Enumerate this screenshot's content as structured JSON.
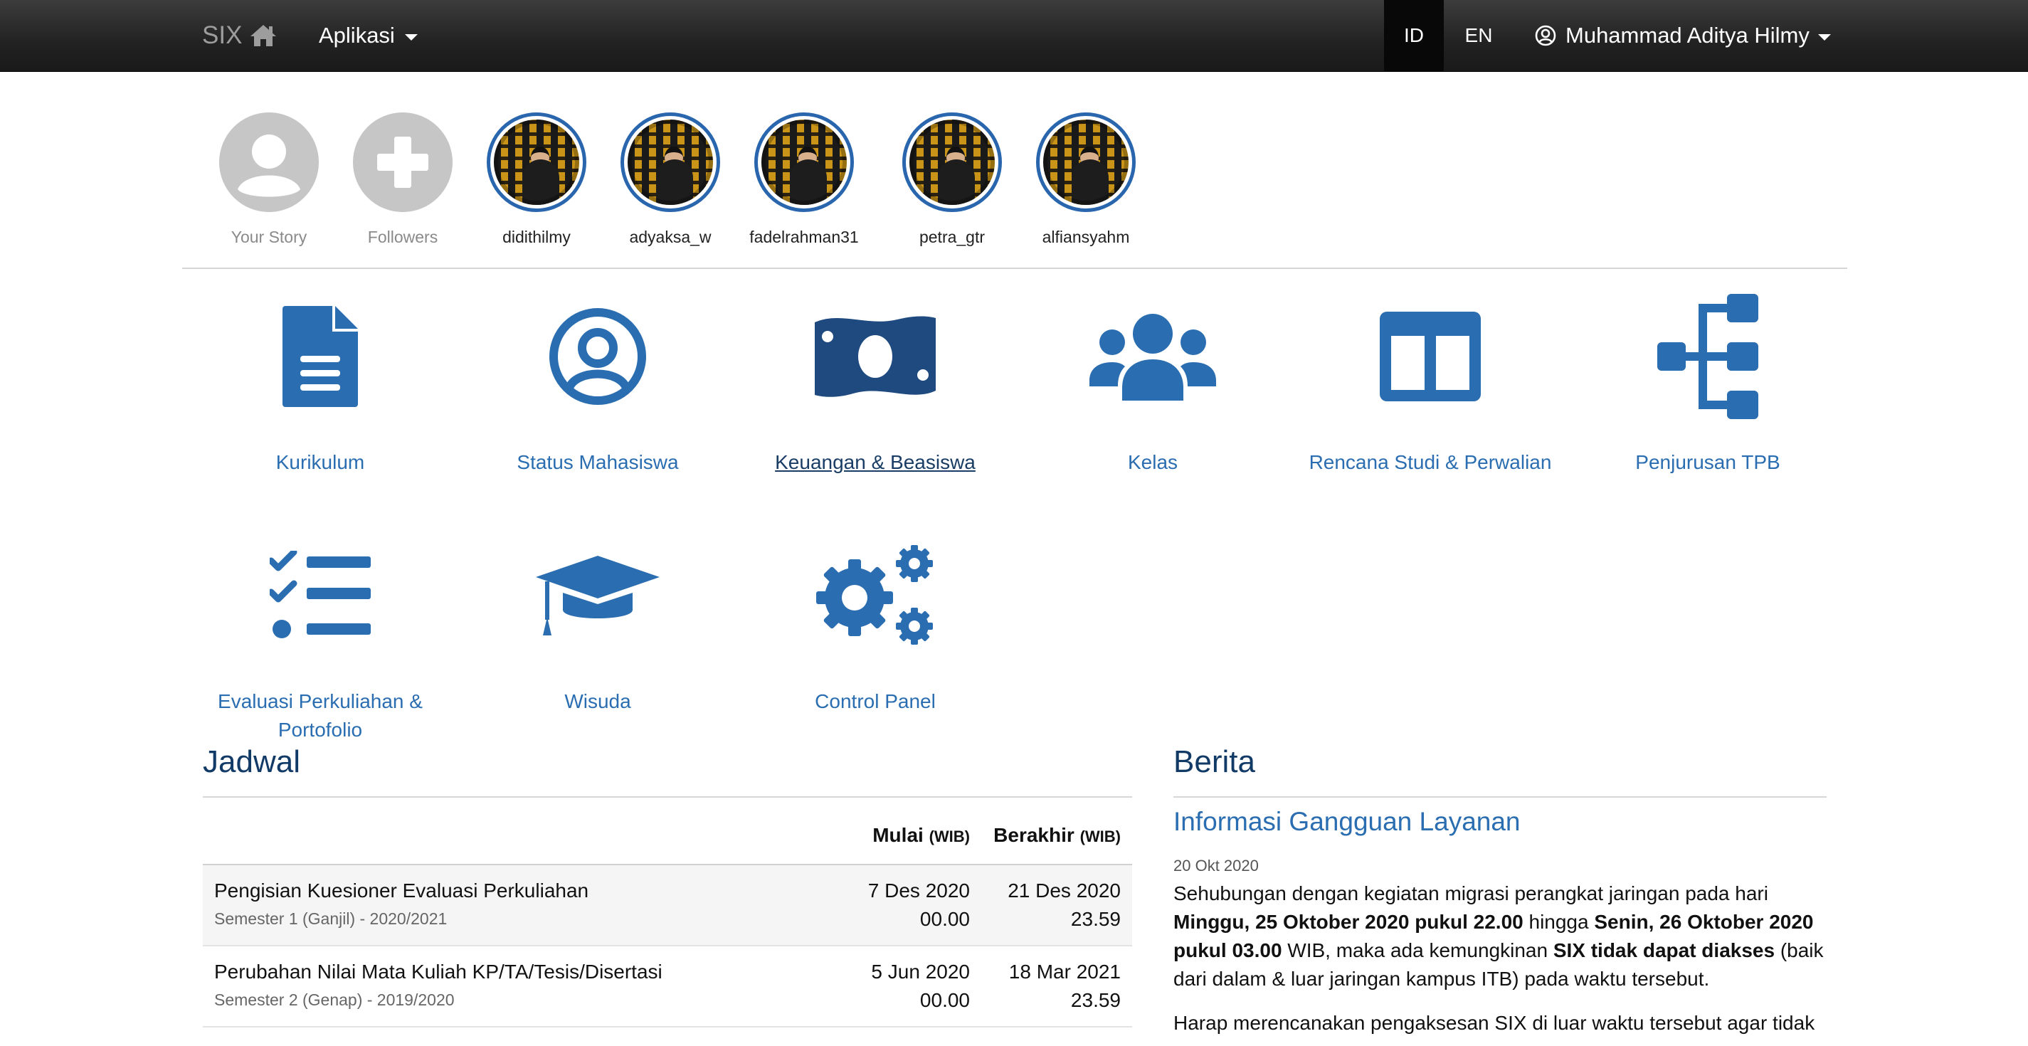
{
  "navbar": {
    "brand": "SIX",
    "apps_menu": "Aplikasi",
    "lang_id": "ID",
    "lang_en": "EN",
    "user_name": "Muhammad Aditya Hilmy"
  },
  "stories": [
    {
      "label": "Your Story",
      "type": "placeholder"
    },
    {
      "label": "Followers",
      "type": "add"
    },
    {
      "label": "didithilmy",
      "type": "photo"
    },
    {
      "label": "adyaksa_w",
      "type": "photo"
    },
    {
      "label": "fadelrahman31",
      "type": "photo"
    },
    {
      "label": "petra_gtr",
      "type": "photo"
    },
    {
      "label": "alfiansyahm",
      "type": "photo"
    }
  ],
  "apps": [
    {
      "label": "Kurikulum",
      "icon": "file-document-icon"
    },
    {
      "label": "Status Mahasiswa",
      "icon": "user-circle-icon"
    },
    {
      "label": "Keuangan & Beasiswa",
      "icon": "money-bill-icon"
    },
    {
      "label": "Kelas",
      "icon": "users-group-icon"
    },
    {
      "label": "Rencana Studi & Perwalian",
      "icon": "columns-icon"
    },
    {
      "label": "Penjurusan TPB",
      "icon": "sitemap-icon"
    },
    {
      "label": "Evaluasi Perkuliahan & Portofolio",
      "icon": "checklist-icon"
    },
    {
      "label": "Wisuda",
      "icon": "graduation-cap-icon"
    },
    {
      "label": "Control Panel",
      "icon": "cogs-icon"
    }
  ],
  "jadwal": {
    "title": "Jadwal",
    "col_mulai": "Mulai",
    "col_berakhir": "Berakhir",
    "tz": "(WIB)",
    "rows": [
      {
        "title": "Pengisian Kuesioner Evaluasi Perkuliahan",
        "sub": "Semester 1 (Ganjil) - 2020/2021",
        "mulai_date": "7 Des 2020",
        "mulai_time": "00.00",
        "akhir_date": "21 Des 2020",
        "akhir_time": "23.59"
      },
      {
        "title": "Perubahan Nilai Mata Kuliah KP/TA/Tesis/Disertasi",
        "sub": "Semester 2 (Genap) - 2019/2020",
        "mulai_date": "5 Jun 2020",
        "mulai_time": "00.00",
        "akhir_date": "18 Mar 2021",
        "akhir_time": "23.59"
      }
    ]
  },
  "berita": {
    "title": "Berita",
    "item_title": "Informasi Gangguan Layanan",
    "item_date": "20 Okt 2020",
    "p1_a": "Sehubungan dengan kegiatan migrasi perangkat jaringan pada hari ",
    "p1_b": "Minggu, 25 Oktober 2020 pukul 22.00",
    "p1_c": " hingga ",
    "p1_d": "Senin, 26 Oktober 2020 pukul 03.00",
    "p1_e": " WIB, maka ada kemungkinan ",
    "p1_f": "SIX tidak dapat diakses",
    "p1_g": " (baik dari dalam & luar jaringan kampus ITB) pada waktu tersebut.",
    "p2": "Harap merencanakan pengaksesan SIX di luar waktu tersebut agar tidak"
  },
  "colors": {
    "navbar": "#222222",
    "accent_blue": "#2a6db0",
    "title_navy": "#123a66",
    "story_ring": "#2a66ad"
  }
}
